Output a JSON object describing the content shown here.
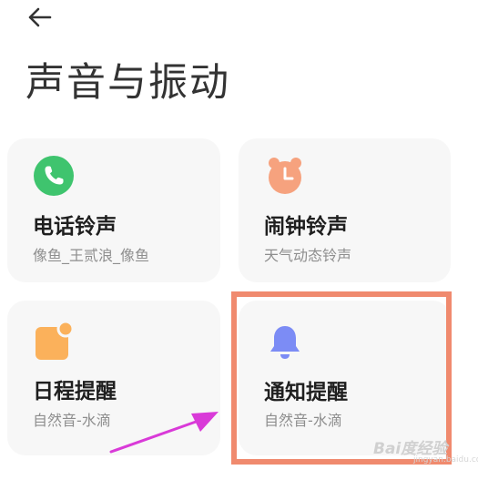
{
  "page": {
    "title": "声音与振动"
  },
  "icons": {
    "back": "arrow-left-icon",
    "ringtone": "phone-icon",
    "alarm": "alarm-clock-icon",
    "schedule": "calendar-icon",
    "notify": "bell-icon"
  },
  "colors": {
    "ringtone_icon": "#3fc46e",
    "alarm_icon": "#f6a27e",
    "schedule_icon": "#fbb15b",
    "notify_icon": "#7c8cf5",
    "highlight": "#f08a6e",
    "arrow": "#d93ad8"
  },
  "cards": [
    {
      "title": "电话铃声",
      "subtitle": "像鱼_王贰浪_像鱼"
    },
    {
      "title": "闹钟铃声",
      "subtitle": "天气动态铃声"
    },
    {
      "title": "日程提醒",
      "subtitle": "自然音-水滴"
    },
    {
      "title": "通知提醒",
      "subtitle": "自然音-水滴"
    }
  ],
  "watermark": {
    "line1": "Bai度经验",
    "line2": "jingyan.baidu.com"
  }
}
